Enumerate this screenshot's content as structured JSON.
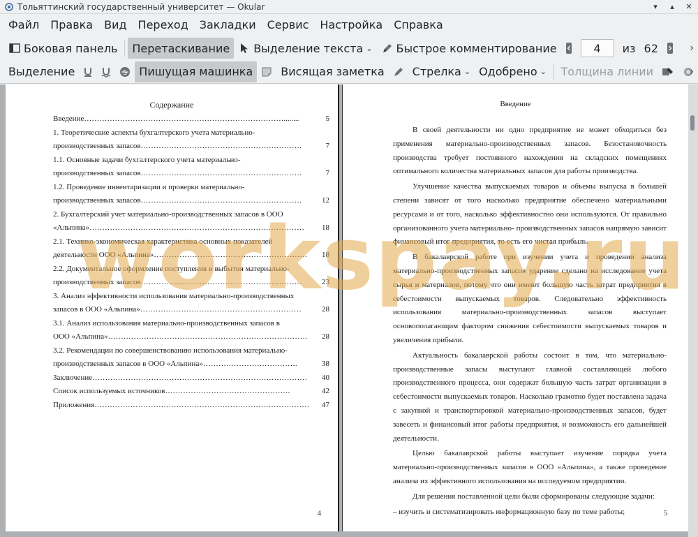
{
  "window": {
    "title": "Тольяттинский государственный университет  — Okular"
  },
  "menu": [
    "Файл",
    "Правка",
    "Вид",
    "Переход",
    "Закладки",
    "Сервис",
    "Настройка",
    "Справка"
  ],
  "toolbar1": {
    "sidebar": "Боковая панель",
    "drag": "Перетаскивание",
    "text_select": "Выделение текста",
    "quick_comment": "Быстрое комментирование",
    "page_current": "4",
    "page_of": "из",
    "page_total": "62"
  },
  "toolbar2": {
    "highlight": "Выделение",
    "typewriter": "Пишущая машинка",
    "popup_note": "Висящая заметка",
    "arrow": "Стрелка",
    "stamp": "Одобрено",
    "line_width": "Толщина линии"
  },
  "watermark": "workspay.ru",
  "left_page": {
    "title": "Содержание",
    "page_number": "4",
    "toc": [
      {
        "text": "Введение……………………………………………………………………........",
        "page": "5"
      },
      {
        "text": "1.   Теоретические   аспекты   бухгалтерского   учета   материально-",
        "page": ""
      },
      {
        "text": "производственных запасов………………………………………………………",
        "page": "7"
      },
      {
        "text": "1.1.   Основные   задачи   бухгалтерского   учета   материально-",
        "page": ""
      },
      {
        "text": "производственных запасов………………………………………………………",
        "page": "7"
      },
      {
        "text": "1.2.   Проведение   инвентаризации   и   проверки   материально-",
        "page": ""
      },
      {
        "text": "производственных запасов………………………………………………………",
        "page": "12"
      },
      {
        "text": "2. Бухгалтерский учет материально-производственных запасов в ООО",
        "page": ""
      },
      {
        "text": "«Альпина»…………………………………………………………………………",
        "page": "18"
      },
      {
        "text": "2.1. Технико-экономическая характеристика основных показателей",
        "page": ""
      },
      {
        "text": "деятельности ООО «Альпина»……………………………………………………",
        "page": "18"
      },
      {
        "text": "2.2. Документальное оформление поступления и выбытия материально-",
        "page": ""
      },
      {
        "text": "производственных запасов………………………………………………………",
        "page": "23"
      },
      {
        "text": "3. Анализ эффективности использования материально-производственных",
        "page": ""
      },
      {
        "text": "запасов в ООО «Альпина»………………………………………………………",
        "page": "28"
      },
      {
        "text": "3.1. Анализ использования материально-производственных запасов в",
        "page": ""
      },
      {
        "text": "ООО «Альпина»……………………………………………………………………",
        "page": "28"
      },
      {
        "text": "3.2. Рекомендации по совершенствованию использования материально-",
        "page": ""
      },
      {
        "text": "производственных запасов в ООО «Альпина»……………………………….",
        "page": "38"
      },
      {
        "text": "Заключение…………………………………………………………………………",
        "page": "40"
      },
      {
        "text": "Список используемых источников………………………………………….",
        "page": "42"
      },
      {
        "text": "Приложения…………………………………………………………………………",
        "page": "47"
      }
    ]
  },
  "right_page": {
    "title": "Введение",
    "page_number": "5",
    "paragraphs": [
      "В своей деятельности ни одно предприятие не может обходиться без применения материально-производственных запасов. Безостановочность производства требует постоянного нахождения на складских помещениях оптимального количества материальных запасов для работы производства.",
      "Улучшение качества выпускаемых товаров и объемы выпуска в большей степени зависят от того насколько предприятие обеспечено материальными ресурсами и от того, насколько эффективностно они используются. От правильно организованного учета материально- производственных запасов напрямую зависит финансовый итог предприятия, то есть его чистая прибыль.",
      "В бакалаврской работе при изучении учета и проведении анализа материально-производственных запасов ударение сделано на исследование учета сырья и материалов, потому что они имеют большую часть затрат предприятия в себестоимости выпускаемых товаров. Следовательно эффективность использования материально-производственных запасов выступает основополагающим фактором снижения себестоимости выпускаемых товаров и увеличения прибыли.",
      "Актуальность бакалаврской работы состоит в том, что материально-производственные запасы выступают главной составляющей любого производственного процесса, они содержат большую часть затрат организации в себестоимости выпускаемых товаров. Насколько грамотно будет поставлена задача с закупкой и транспортировкой материально-производственных запасов, будет завесеть и финансовый итог работы предприятия, и возможность его дальнейшей деятельности.",
      "Целью бакалаврской работы выступает изучение порядка учета материально-производственных запасов в ООО «Альпина», а также проведение анализа их эффективного использования на исследуемом предприятии.",
      "Для решения поставленной цели были сформированы следующие задачи:",
      "–   изучить и систематизировать информационную базу по теме работы;"
    ]
  }
}
